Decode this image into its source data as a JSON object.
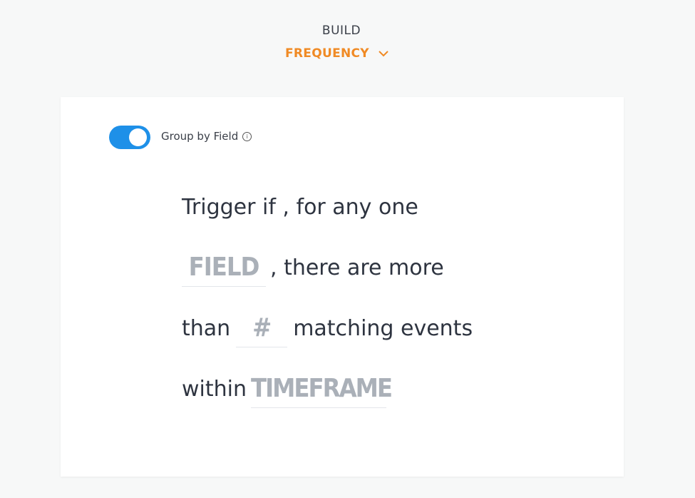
{
  "header": {
    "build_label": "BUILD",
    "frequency_label": "FREQUENCY",
    "frequency_color": "#f08a24"
  },
  "card": {
    "toggle": {
      "label": "Group by Field",
      "on": true,
      "color": "#1e90e8"
    },
    "info_icon": "info-icon",
    "sentence": {
      "line1": "Trigger if , for any one",
      "field_placeholder": "FIELD",
      "line2_rest": ", there are more",
      "line3_start": "than",
      "count_placeholder": "#",
      "line3_rest": "matching events",
      "line4_start": "within",
      "timeframe_placeholder": "TIMEFRAME"
    }
  }
}
